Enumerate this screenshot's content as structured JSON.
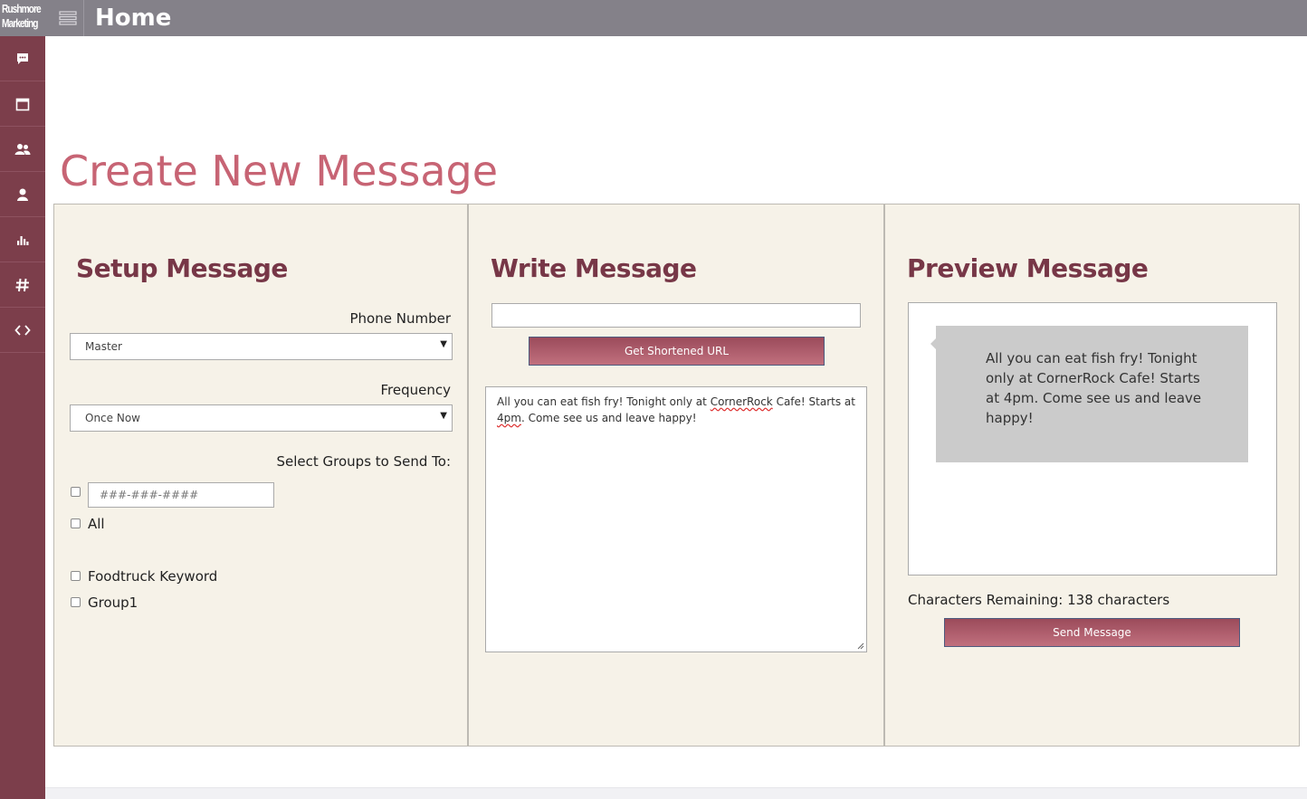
{
  "app": {
    "logo_line1": "Rushmore",
    "logo_line2": "Marketing",
    "title": "Home"
  },
  "sidebar": {
    "items": [
      {
        "icon": "chat-icon"
      },
      {
        "icon": "calendar-icon"
      },
      {
        "icon": "users-icon"
      },
      {
        "icon": "user-icon"
      },
      {
        "icon": "bar-chart-icon"
      },
      {
        "icon": "hashtag-icon"
      },
      {
        "icon": "code-icon"
      }
    ]
  },
  "page": {
    "heading": "Create New Message"
  },
  "setup": {
    "title": "Setup Message",
    "phone_label": "Phone Number",
    "phone_value": "Master",
    "frequency_label": "Frequency",
    "frequency_value": "Once Now",
    "groups_label": "Select Groups to Send To:",
    "phone_placeholder": "###-###-####",
    "groups": [
      "All",
      "Foodtruck Keyword",
      "Group1"
    ]
  },
  "write": {
    "title": "Write Message",
    "shorten_button": "Get Shortened URL",
    "message_part1": "All you can eat fish fry! Tonight only at ",
    "message_word1": "CornerRock",
    "message_part2": " Cafe! Starts at ",
    "message_word2": "4pm",
    "message_part3": ". Come see us and leave happy!"
  },
  "preview": {
    "title": "Preview Message",
    "bubble_text": "All you can eat fish fry! Tonight only at CornerRock Cafe! Starts at 4pm. Come see us and leave happy!",
    "chars_remaining": "Characters Remaining: 138 characters",
    "send_button": "Send Message"
  },
  "colors": {
    "topbar": "#848189",
    "sidebar": "#7c3e4b",
    "heading": "#c76474",
    "panel_title": "#773747",
    "panel_bg": "#f6f2e8"
  }
}
